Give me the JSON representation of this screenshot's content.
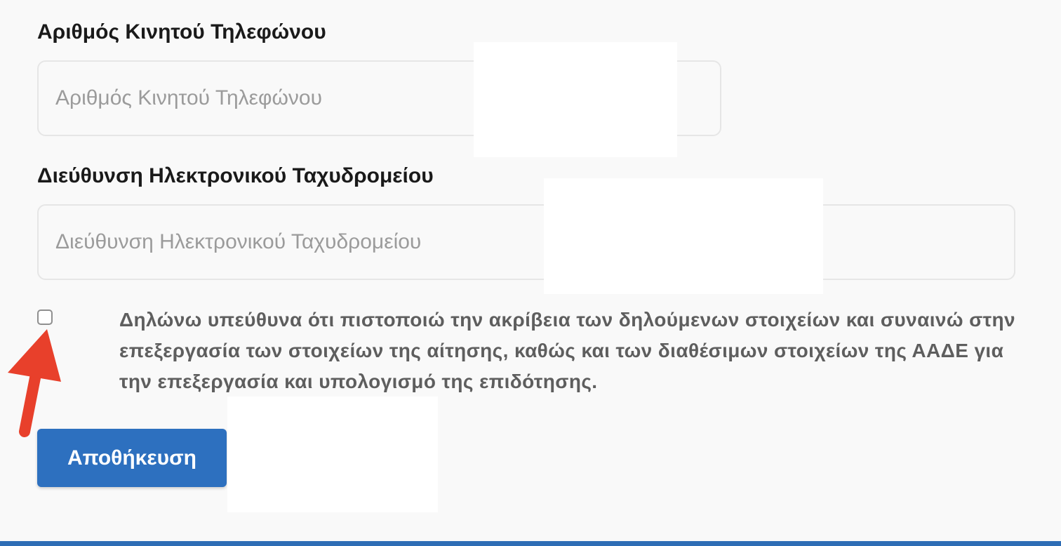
{
  "form": {
    "mobile": {
      "label": "Αριθμός Κινητού Τηλεφώνου",
      "placeholder": "Αριθμός Κινητού Τηλεφώνου",
      "value": ""
    },
    "email": {
      "label": "Διεύθυνση Ηλεκτρονικού Ταχυδρομείου",
      "placeholder": "Διεύθυνση Ηλεκτρονικού Ταχυδρομείου",
      "value": ""
    },
    "declaration": {
      "checked": false,
      "text": "Δηλώνω υπεύθυνα ότι πιστοποιώ την ακρίβεια των δηλούμενων στοιχείων και συναινώ στην επεξεργασία των στοιχείων της αίτησης, καθώς και των διαθέσιμων στοιχείων της ΑΑΔΕ για την επεξεργασία και υπολογισμό της επιδότησης."
    },
    "save_label": "Αποθήκευση"
  },
  "colors": {
    "primary": "#2d70bf",
    "annotation_arrow": "#e8402b",
    "background": "#f9f9f9",
    "bottom_bar": "#2e6db5"
  }
}
